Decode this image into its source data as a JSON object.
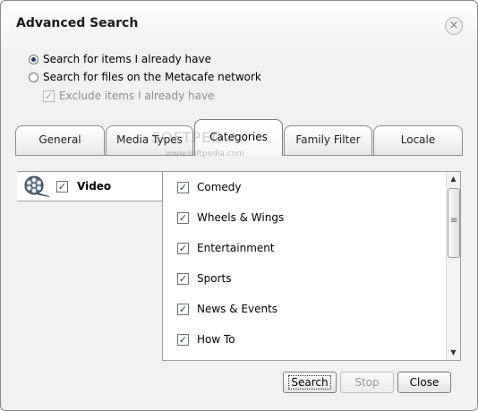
{
  "dialog": {
    "title": "Advanced Search",
    "close_glyph": "×"
  },
  "options": {
    "radio_have": "Search for items I already have",
    "radio_network": "Search for files on the Metacafe network",
    "exclude": "Exclude items I already have"
  },
  "tabs": [
    "General",
    "Media Types",
    "Categories",
    "Family Filter",
    "Locale"
  ],
  "active_tab": "Categories",
  "watermark": {
    "main": "SOFTPEDIA",
    "sub": "www.softpedia.com"
  },
  "media": {
    "label": "Video",
    "icon": "film-reel-icon"
  },
  "categories": [
    "Comedy",
    "Wheels & Wings",
    "Entertainment",
    "Sports",
    "News & Events",
    "How To"
  ],
  "check_glyph": "✓",
  "scroll": {
    "up": "▲",
    "down": "▼",
    "grip": "≡"
  },
  "buttons": {
    "search": "Search",
    "stop": "Stop",
    "close": "Close"
  },
  "colors": {
    "accent": "#1d3a6d",
    "border": "#8c8c8c"
  }
}
